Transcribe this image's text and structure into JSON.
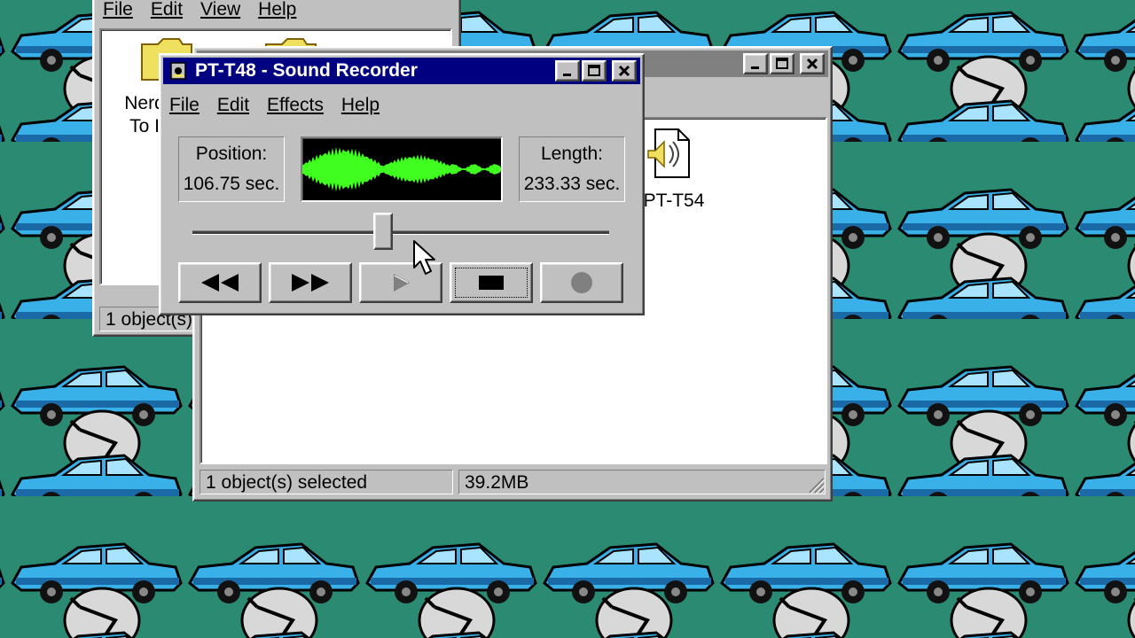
{
  "back_window": {
    "menu": [
      "File",
      "Edit",
      "View",
      "Help"
    ],
    "icons": [
      {
        "label_line1": "Nerd",
        "label_line2": "To I"
      }
    ],
    "status": "1 object(s)"
  },
  "explorer_window": {
    "file_icon_label": "PT-T54",
    "status_left": "1 object(s) selected",
    "status_right": "39.2MB"
  },
  "sound_recorder": {
    "title": "PT-T48 - Sound Recorder",
    "menu": [
      "File",
      "Edit",
      "Effects",
      "Help"
    ],
    "position_label": "Position:",
    "position_value": "106.75 sec.",
    "length_label": "Length:",
    "length_value": "233.33 sec.",
    "slider_fraction": 0.4575,
    "controls": [
      "rewind-button",
      "fast-forward-button",
      "play-button",
      "stop-button",
      "record-button"
    ],
    "wave_color": "#40ff20"
  },
  "colors": {
    "desktop": "#2a8a72",
    "title_active": "#000080",
    "title_inactive": "#808080",
    "face": "#c0c0c0"
  }
}
